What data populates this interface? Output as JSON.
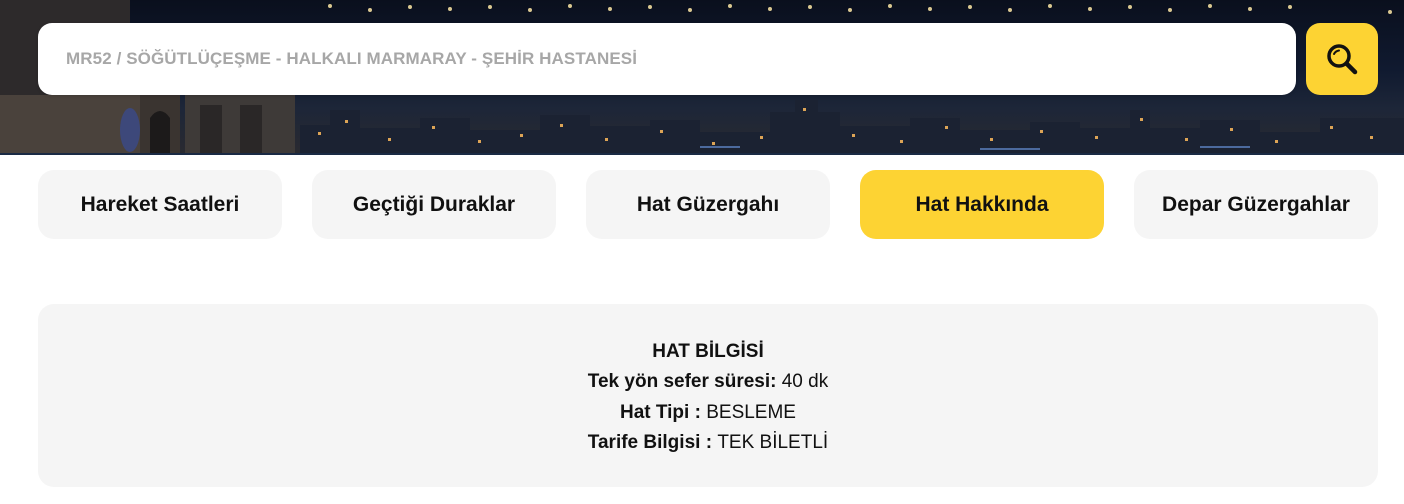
{
  "search": {
    "value": "MR52 / SÖĞÜTLÜÇEŞME - HALKALI MARMARAY - ŞEHİR HASTANESİ",
    "button_icon": "search-icon"
  },
  "tabs": [
    {
      "label": "Hareket Saatleri",
      "active": false
    },
    {
      "label": "Geçtiği Duraklar",
      "active": false
    },
    {
      "label": "Hat Güzergahı",
      "active": false
    },
    {
      "label": "Hat Hakkında",
      "active": true
    },
    {
      "label": "Depar Güzergahlar",
      "active": false
    }
  ],
  "info": {
    "title": "HAT BİLGİSİ",
    "rows": [
      {
        "label": "Tek yön sefer süresi:",
        "value": "40 dk"
      },
      {
        "label": "Hat Tipi :",
        "value": "BESLEME"
      },
      {
        "label": "Tarife Bilgisi :",
        "value": "TEK BİLETLİ"
      }
    ]
  },
  "colors": {
    "accent": "#fdd333",
    "tab_background": "#f5f5f5",
    "text": "#111111",
    "placeholder": "#a7a7a7"
  }
}
